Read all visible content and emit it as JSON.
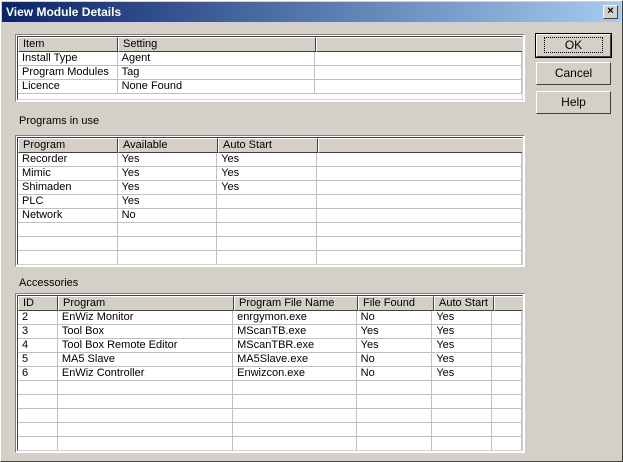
{
  "window": {
    "title": "View Module Details",
    "close_glyph": "×"
  },
  "buttons": {
    "ok": "OK",
    "cancel": "Cancel",
    "help": "Help"
  },
  "details": {
    "columns": [
      "Item",
      "Setting"
    ],
    "rows": [
      [
        "Install Type",
        "Agent"
      ],
      [
        "Program Modules",
        "Tag"
      ],
      [
        "Licence",
        "None Found"
      ]
    ]
  },
  "programs": {
    "label": "Programs in use",
    "columns": [
      "Program",
      "Available",
      "Auto Start"
    ],
    "rows": [
      [
        "Recorder",
        "Yes",
        "Yes"
      ],
      [
        "Mimic",
        "Yes",
        "Yes"
      ],
      [
        "Shimaden",
        "Yes",
        "Yes"
      ],
      [
        "PLC",
        "Yes",
        ""
      ],
      [
        "Network",
        "No",
        ""
      ]
    ]
  },
  "accessories": {
    "label": "Accessories",
    "columns": [
      "ID",
      "Program",
      "Program File Name",
      "File Found",
      "Auto Start"
    ],
    "rows": [
      [
        "2",
        "EnWiz Monitor",
        "enrgymon.exe",
        "No",
        "Yes"
      ],
      [
        "3",
        "Tool Box",
        "MScanTB.exe",
        "Yes",
        "Yes"
      ],
      [
        "4",
        "Tool Box Remote Editor",
        "MScanTBR.exe",
        "Yes",
        "Yes"
      ],
      [
        "5",
        "MA5 Slave",
        "MA5Slave.exe",
        "No",
        "Yes"
      ],
      [
        "6",
        "EnWiz Controller",
        "Enwizcon.exe",
        "No",
        "Yes"
      ]
    ]
  }
}
